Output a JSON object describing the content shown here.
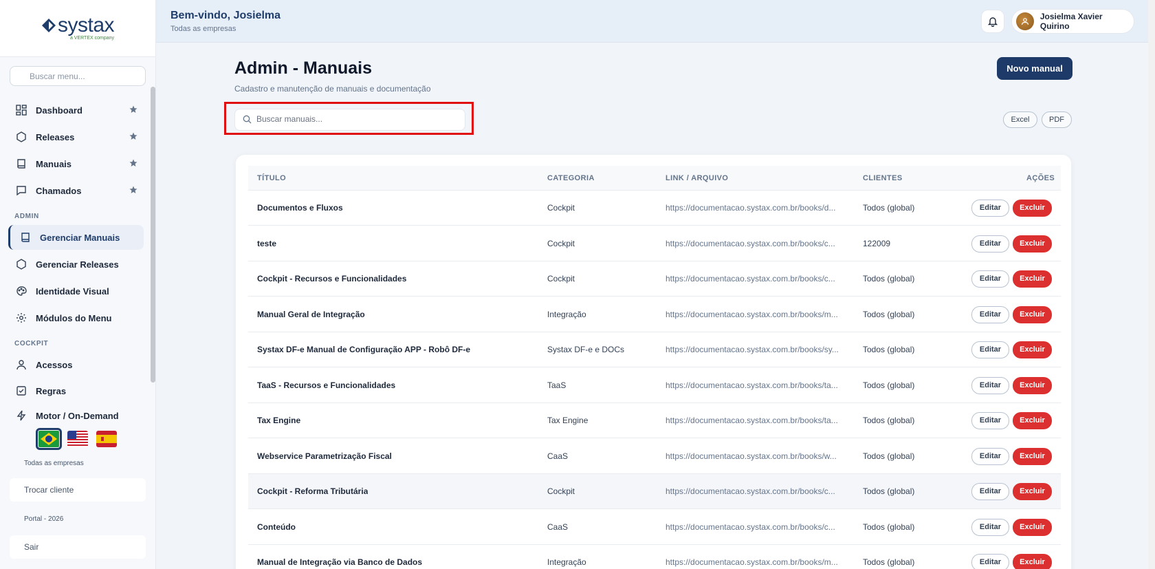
{
  "brand": {
    "name": "systax",
    "tagline": "a VERTEX company"
  },
  "sidebar": {
    "search_placeholder": "Buscar menu...",
    "items": [
      {
        "label": "Dashboard",
        "icon": "dashboard-icon",
        "favorite": true
      },
      {
        "label": "Releases",
        "icon": "hexagon-icon",
        "favorite": true
      },
      {
        "label": "Manuais",
        "icon": "book-icon",
        "favorite": true
      },
      {
        "label": "Chamados",
        "icon": "chat-icon",
        "favorite": true
      }
    ],
    "admin_label": "ADMIN",
    "admin_items": [
      {
        "label": "Gerenciar Manuais",
        "icon": "book-icon",
        "active": true
      },
      {
        "label": "Gerenciar Releases",
        "icon": "hexagon-icon"
      },
      {
        "label": "Identidade Visual",
        "icon": "palette-icon"
      },
      {
        "label": "Módulos do Menu",
        "icon": "gear-icon"
      }
    ],
    "cockpit_label": "COCKPIT",
    "cockpit_items": [
      {
        "label": "Acessos",
        "icon": "user-icon"
      },
      {
        "label": "Regras",
        "icon": "checkbox-icon"
      },
      {
        "label": "Motor / On-Demand",
        "icon": "bolt-icon"
      }
    ],
    "languages": [
      "pt-BR",
      "en-US",
      "es-ES"
    ],
    "company_scope": "Todas as empresas",
    "switch_client": "Trocar cliente",
    "portal_label": "Portal - 2026",
    "logout": "Sair"
  },
  "header": {
    "welcome": "Bem-vindo, Josielma",
    "subtitle": "Todas as empresas",
    "user_name": "Josielma Xavier Quirino"
  },
  "main": {
    "title": "Admin - Manuais",
    "subtitle": "Cadastro e manutenção de manuais e documentação",
    "new_button": "Novo manual",
    "search_placeholder": "Buscar manuais...",
    "export_excel": "Excel",
    "export_pdf": "PDF",
    "columns": [
      "TÍTULO",
      "CATEGORIA",
      "LINK / ARQUIVO",
      "CLIENTES",
      "AÇÕES"
    ],
    "edit_label": "Editar",
    "delete_label": "Excluir",
    "rows": [
      {
        "title": "Documentos e Fluxos",
        "category": "Cockpit",
        "link": "https://documentacao.systax.com.br/books/d...",
        "clients": "Todos (global)"
      },
      {
        "title": "teste",
        "category": "Cockpit",
        "link": "https://documentacao.systax.com.br/books/c...",
        "clients": "122009"
      },
      {
        "title": "Cockpit - Recursos e Funcionalidades",
        "category": "Cockpit",
        "link": "https://documentacao.systax.com.br/books/c...",
        "clients": "Todos (global)"
      },
      {
        "title": "Manual Geral de Integração",
        "category": "Integração",
        "link": "https://documentacao.systax.com.br/books/m...",
        "clients": "Todos (global)"
      },
      {
        "title": "Systax DF-e Manual de Configuração APP - Robô DF-e",
        "category": "Systax DF-e e DOCs",
        "link": "https://documentacao.systax.com.br/books/sy...",
        "clients": "Todos (global)"
      },
      {
        "title": "TaaS - Recursos e Funcionalidades",
        "category": "TaaS",
        "link": "https://documentacao.systax.com.br/books/ta...",
        "clients": "Todos (global)"
      },
      {
        "title": "Tax Engine",
        "category": "Tax Engine",
        "link": "https://documentacao.systax.com.br/books/ta...",
        "clients": "Todos (global)"
      },
      {
        "title": "Webservice Parametrização Fiscal",
        "category": "CaaS",
        "link": "https://documentacao.systax.com.br/books/w...",
        "clients": "Todos (global)"
      },
      {
        "title": "Cockpit - Reforma Tributária",
        "category": "Cockpit",
        "link": "https://documentacao.systax.com.br/books/c...",
        "clients": "Todos (global)"
      },
      {
        "title": "Conteúdo",
        "category": "CaaS",
        "link": "https://documentacao.systax.com.br/books/c...",
        "clients": "Todos (global)"
      },
      {
        "title": "Manual de Integração via Banco de Dados",
        "category": "Integração",
        "link": "https://documentacao.systax.com.br/books/m...",
        "clients": "Todos (global)"
      }
    ]
  },
  "colors": {
    "brand_navy": "#1e3a68",
    "danger": "#dc2f2f",
    "highlight": "#e01010"
  }
}
